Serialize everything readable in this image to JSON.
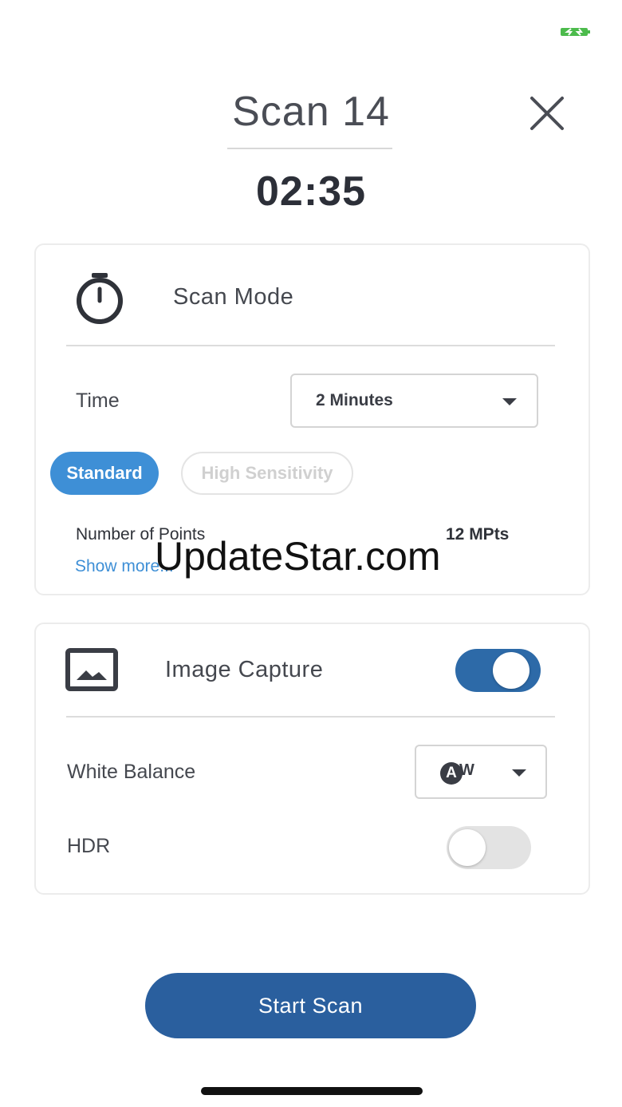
{
  "status_bar": {
    "battery_icon": "battery-charging-icon",
    "battery_color": "#4cbb4c"
  },
  "header": {
    "title": "Scan 14",
    "close_icon": "close-icon",
    "timer": "02:35"
  },
  "scan_mode": {
    "icon": "stopwatch-icon",
    "label": "Scan Mode",
    "time_label": "Time",
    "time_value": "2 Minutes",
    "modes": [
      {
        "label": "Standard",
        "selected": true
      },
      {
        "label": "High Sensitivity",
        "selected": false
      }
    ],
    "points_label": "Number of Points",
    "points_value": "12 MPts",
    "show_more": "Show more..."
  },
  "watermark": "UpdateStar.com",
  "image_capture": {
    "icon": "image-icon",
    "label": "Image Capture",
    "enabled": true,
    "white_balance_label": "White Balance",
    "white_balance_badge": "A",
    "white_balance_suffix": "W",
    "hdr_label": "HDR",
    "hdr_enabled": false
  },
  "start_button": "Start Scan",
  "colors": {
    "accent": "#3e8fd6",
    "primary_button": "#2a5f9e",
    "toggle_on": "#2d6aa8"
  }
}
